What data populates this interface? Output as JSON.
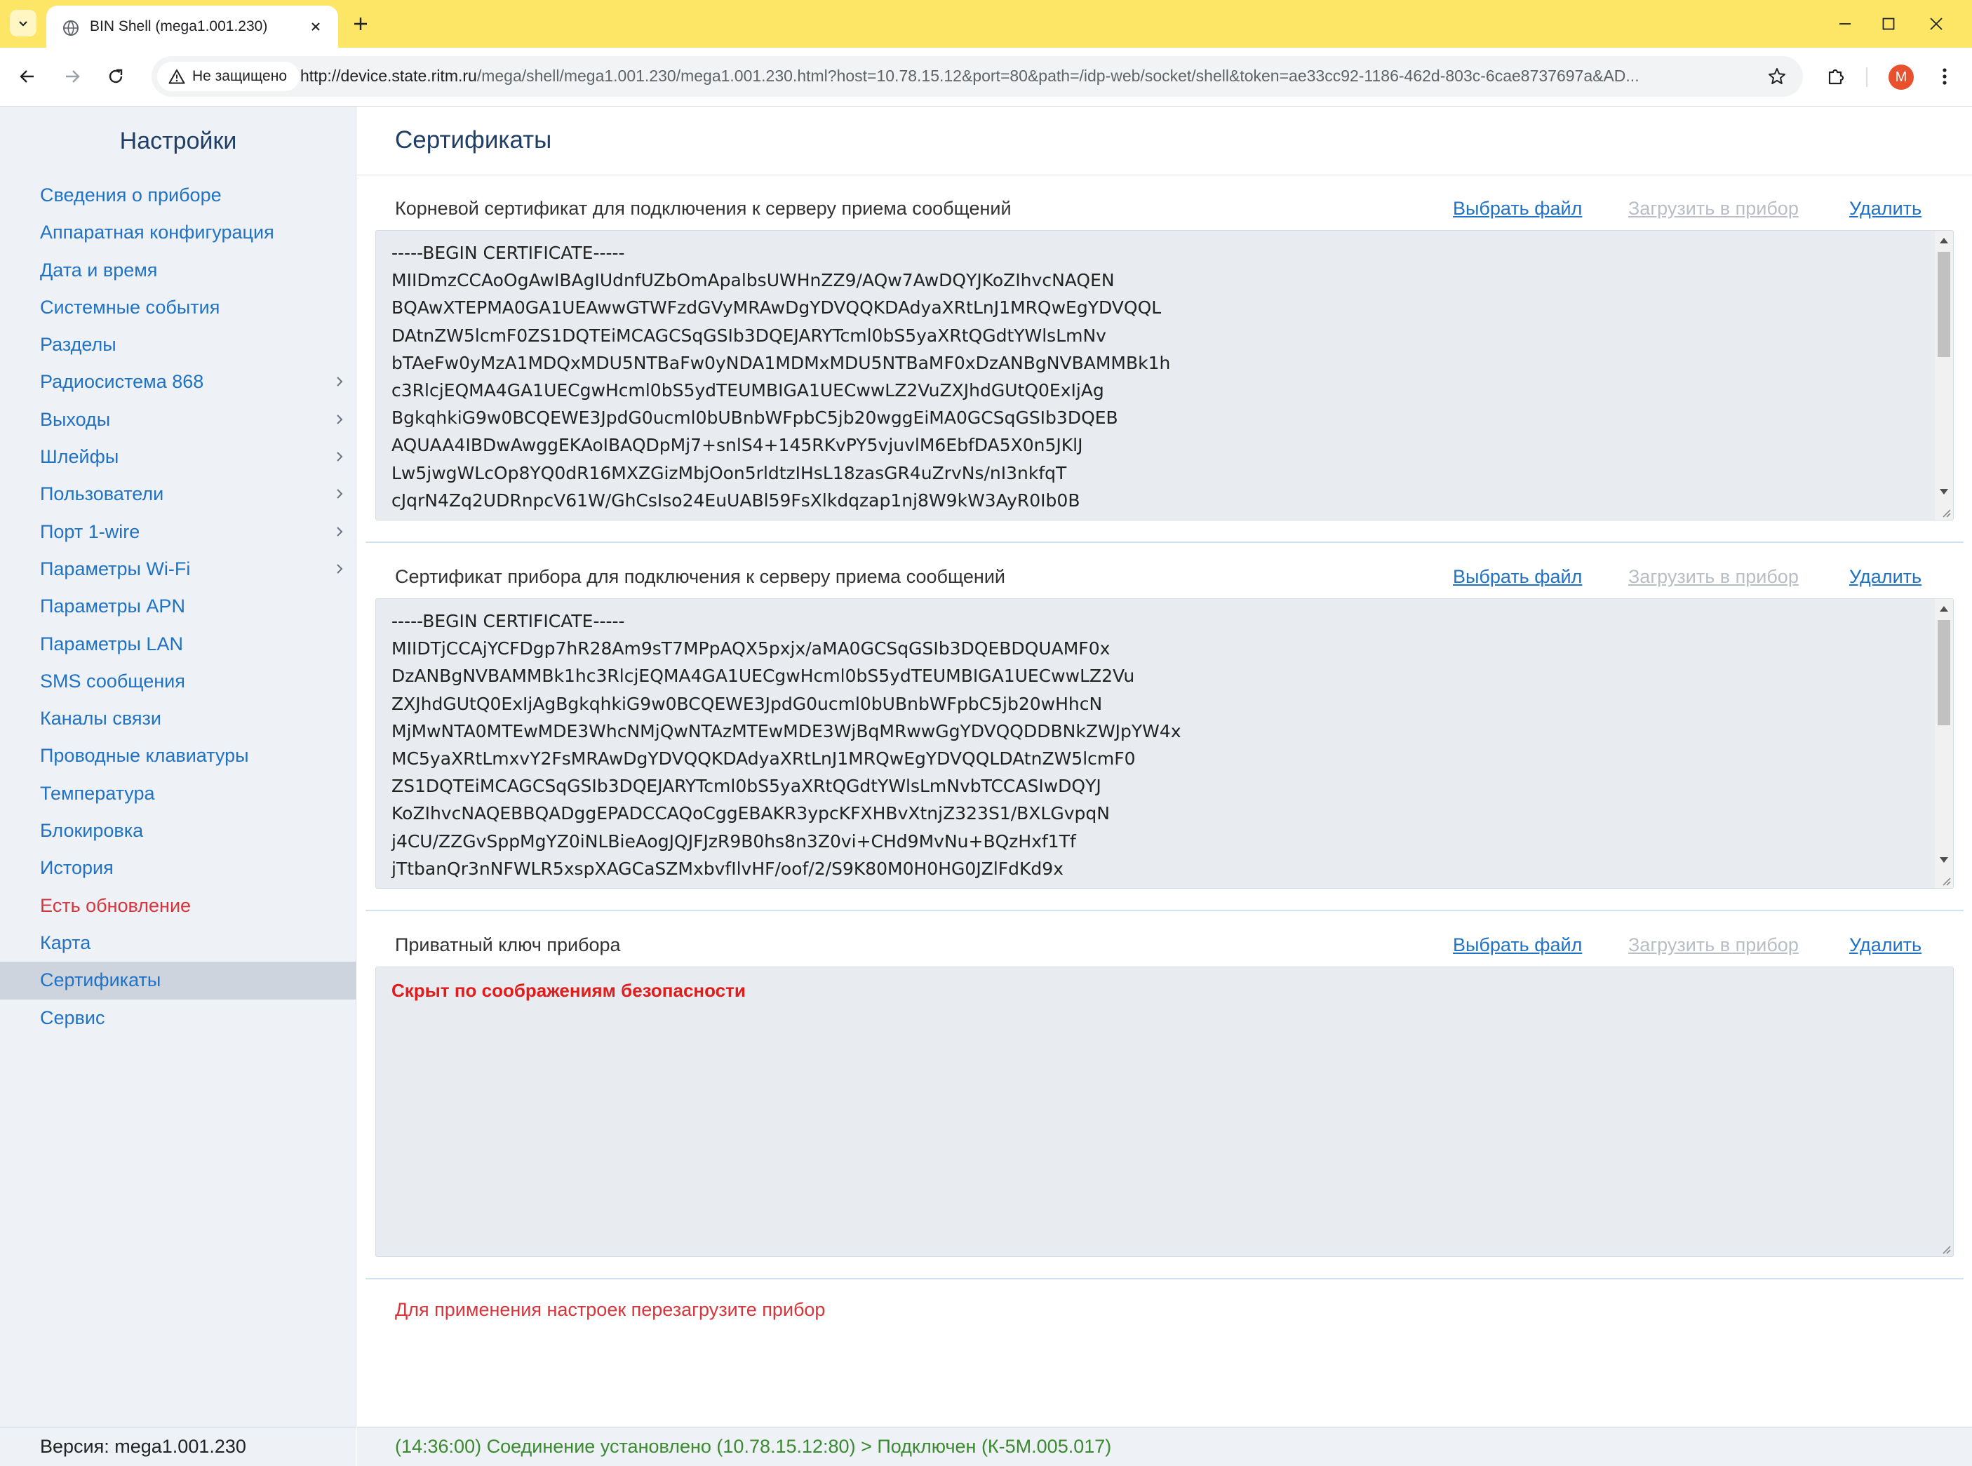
{
  "browser": {
    "tab_title": "BIN Shell (mega1.001.230)",
    "security_label": "Не защищено",
    "url_host": "http://device.state.ritm.ru",
    "url_rest": "/mega/shell/mega1.001.230/mega1.001.230.html?host=10.78.15.12&port=80&path=/idp-web/socket/shell&token=ae33cc92-1186-462d-803c-6cae8737697a&AD...",
    "profile_initial": "M",
    "colors": {
      "tab_strip": "#fde565",
      "profile": "#e8502e"
    }
  },
  "sidebar": {
    "title": "Настройки",
    "items": [
      {
        "label": "Сведения о приборе",
        "has_submenu": false
      },
      {
        "label": "Аппаратная конфигурация",
        "has_submenu": false
      },
      {
        "label": "Дата и время",
        "has_submenu": false
      },
      {
        "label": "Системные события",
        "has_submenu": false
      },
      {
        "label": "Разделы",
        "has_submenu": false
      },
      {
        "label": "Радиосистема 868",
        "has_submenu": true
      },
      {
        "label": "Выходы",
        "has_submenu": true
      },
      {
        "label": "Шлейфы",
        "has_submenu": true
      },
      {
        "label": "Пользователи",
        "has_submenu": true
      },
      {
        "label": "Порт 1-wire",
        "has_submenu": true
      },
      {
        "label": "Параметры Wi-Fi",
        "has_submenu": true
      },
      {
        "label": "Параметры APN",
        "has_submenu": false
      },
      {
        "label": "Параметры LAN",
        "has_submenu": false
      },
      {
        "label": "SMS сообщения",
        "has_submenu": false
      },
      {
        "label": "Каналы связи",
        "has_submenu": false
      },
      {
        "label": "Проводные клавиатуры",
        "has_submenu": false
      },
      {
        "label": "Температура",
        "has_submenu": false
      },
      {
        "label": "Блокировка",
        "has_submenu": false
      },
      {
        "label": "История",
        "has_submenu": false
      },
      {
        "label": "Есть обновление",
        "has_submenu": false,
        "warning": true
      },
      {
        "label": "Карта",
        "has_submenu": false
      },
      {
        "label": "Сертификаты",
        "has_submenu": false,
        "active": true
      },
      {
        "label": "Сервис",
        "has_submenu": false
      }
    ],
    "version": "Версия: mega1.001.230"
  },
  "main": {
    "title": "Сертификаты",
    "actions": {
      "choose_file": "Выбрать файл",
      "upload": "Загрузить в прибор",
      "delete": "Удалить"
    },
    "root_cert": {
      "label": "Корневой сертификат для подключения к серверу приема сообщений",
      "content": "-----BEGIN CERTIFICATE-----\nMIIDmzCCAoOgAwIBAgIUdnfUZbOmApalbsUWHnZZ9/AQw7AwDQYJKoZIhvcNAQEN\nBQAwXTEPMA0GA1UEAwwGTWFzdGVyMRAwDgYDVQQKDAdyaXRtLnJ1MRQwEgYDVQQL\nDAtnZW5lcmF0ZS1DQTEiMCAGCSqGSIb3DQEJARYTcml0bS5yaXRtQGdtYWlsLmNv\nbTAeFw0yMzA1MDQxMDU5NTBaFw0yNDA1MDMxMDU5NTBaMF0xDzANBgNVBAMMBk1h\nc3RlcjEQMA4GA1UECgwHcml0bS5ydTEUMBIGA1UECwwLZ2VuZXJhdGUtQ0ExIjAg\nBgkqhkiG9w0BCQEWE3JpdG0ucml0bUBnbWFpbC5jb20wggEiMA0GCSqGSIb3DQEB\nAQUAA4IBDwAwggEKAoIBAQDpMj7+snlS4+145RKvPY5vjuvlM6EbfDA5X0n5JKlJ\nLw5jwgWLcOp8YQ0dR16MXZGizMbjOon5rldtzIHsL18zasGR4uZrvNs/nI3nkfqT\ncJqrN4Zq2UDRnpcV61W/GhCsIso24EuUABl59FsXlkdqzap1nj8W9kW3AyR0Ib0B"
    },
    "device_cert": {
      "label": "Сертификат прибора для подключения к серверу приема сообщений",
      "content": "-----BEGIN CERTIFICATE-----\nMIIDTjCCAjYCFDgp7hR28Am9sT7MPpAQX5pxjx/aMA0GCSqGSIb3DQEBDQUAMF0x\nDzANBgNVBAMMBk1hc3RlcjEQMA4GA1UECgwHcml0bS5ydTEUMBIGA1UECwwLZ2Vu\nZXJhdGUtQ0ExIjAgBgkqhkiG9w0BCQEWE3JpdG0ucml0bUBnbWFpbC5jb20wHhcN\nMjMwNTA0MTEwMDE3WhcNMjQwNTAzMTEwMDE3WjBqMRwwGgYDVQQDDBNkZWJpYW4x\nMC5yaXRtLmxvY2FsMRAwDgYDVQQKDAdyaXRtLnJ1MRQwEgYDVQQLDAtnZW5lcmF0\nZS1DQTEiMCAGCSqGSIb3DQEJARYTcml0bS5yaXRtQGdtYWlsLmNvbTCCASIwDQYJ\nKoZIhvcNAQEBBQADggEPADCCAQoCggEBAKR3ypcKFXHBvXtnjZ323S1/BXLGvpqN\nj4CU/ZZGvSppMgYZ0iNLBieAogJQJFJzR9B0hs8n3Z0vi+CHd9MvNu+BQzHxf1Tf\njTtbanQr3nNFWLR5xspXAGCaSZMxbvfIlvHF/oof/2/S9K80M0H0HG0JZlFdKd9x"
    },
    "private_key": {
      "label": "Приватный ключ прибора",
      "hidden_message": "Скрыт по соображениям безопасности"
    },
    "reboot_note": "Для применения настроек перезагрузите прибор"
  },
  "status": {
    "text": "(14:36:00) Соединение установлено (10.78.15.12:80) > Подключен (К-5М.005.017)"
  }
}
